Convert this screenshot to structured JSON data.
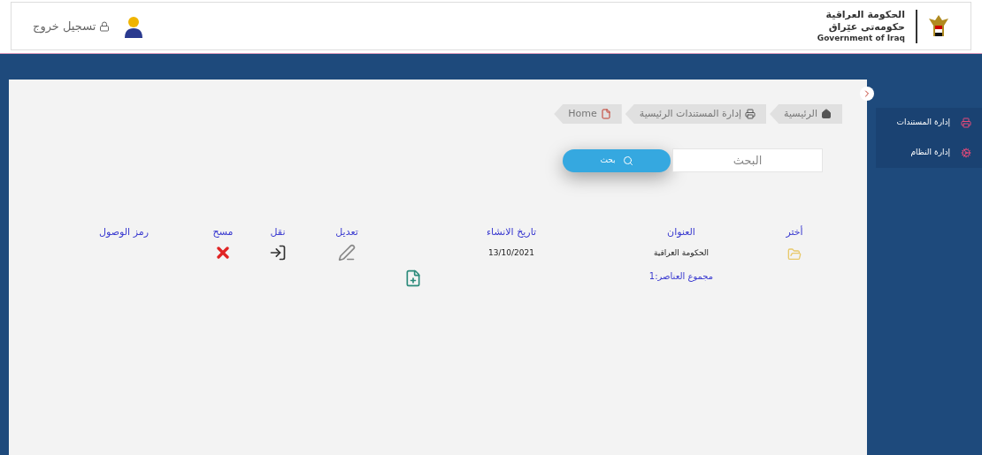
{
  "header": {
    "logout": "تسجيل خروج",
    "brand": [
      "الحكومة العراقية",
      "حكومەتی عێراق",
      "Government of Iraq"
    ]
  },
  "breadcrumbs": [
    {
      "label": "الرئيسية",
      "kind": "home"
    },
    {
      "label": "إدارة المستندات الرئيسية",
      "kind": "documents"
    },
    {
      "label": "Home",
      "kind": "page"
    }
  ],
  "search": {
    "placeholder": "البحث",
    "button": "بحث"
  },
  "sidebar": {
    "items": [
      {
        "label": "إدارة المستندات",
        "kind": "documents"
      },
      {
        "label": "إدارة النظام",
        "kind": "system"
      }
    ]
  },
  "table": {
    "columns": [
      {
        "header": "أختر",
        "kind": "select"
      },
      {
        "header": "العنوان",
        "kind": "text",
        "cell": "الحكومة العراقية",
        "footer": "مجموع العناصر:1"
      },
      {
        "header": "تاريخ الانشاء",
        "kind": "text",
        "cell": "13/10/2021"
      },
      {
        "kind": "add"
      },
      {
        "header": "تعديل",
        "kind": "edit"
      },
      {
        "header": "نقل",
        "kind": "move"
      },
      {
        "header": "مسح",
        "kind": "delete"
      },
      {
        "header": "رمز الوصول",
        "kind": "text"
      }
    ]
  }
}
